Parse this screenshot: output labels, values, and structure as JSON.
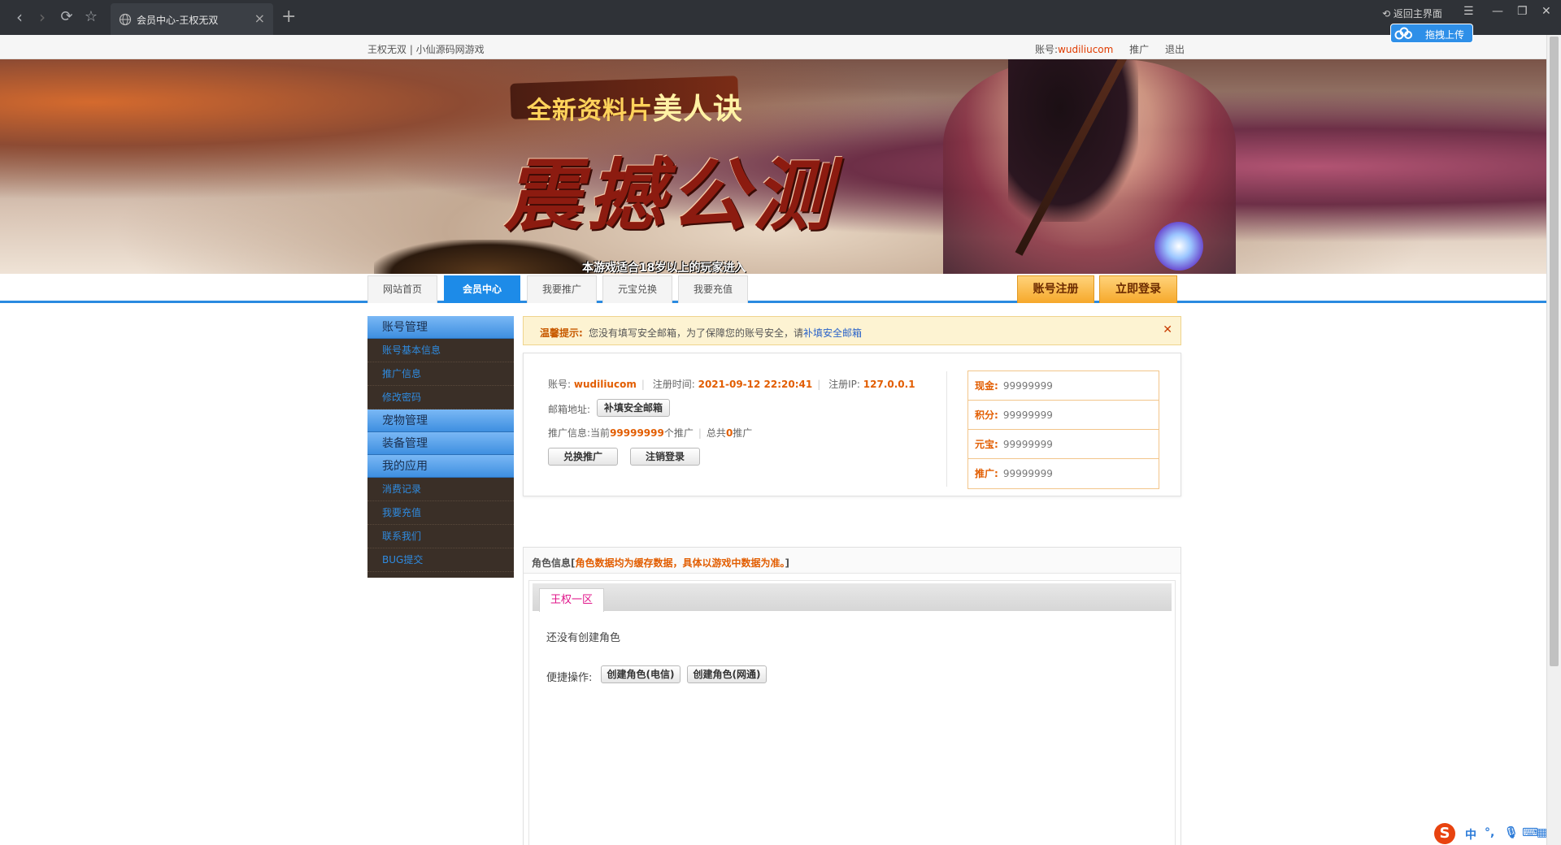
{
  "browser": {
    "tab_title": "会员中心-王权无双",
    "back_home": "返回主界面",
    "upload_label": "拖拽上传"
  },
  "topbar": {
    "site_name": "王权无双 | 小仙源码网游戏",
    "account_label": "账号:",
    "account_name": "wudiliucom",
    "promote_link": "推广",
    "logout_link": "退出"
  },
  "banner": {
    "subtitle_prefix": "全新资料片",
    "subtitle_highlight": "美人诀",
    "title": "震撼公测",
    "age_notice": "本游戏适合18岁以上的玩家进入"
  },
  "nav": {
    "tabs": [
      "网站首页",
      "会员中心",
      "我要推广",
      "元宝兑换",
      "我要充值"
    ],
    "active_index": 1,
    "register": "账号注册",
    "login": "立即登录"
  },
  "sidebar": {
    "sections": [
      {
        "title": "账号管理",
        "items": [
          "账号基本信息",
          "推广信息",
          "修改密码"
        ]
      },
      {
        "title": "宠物管理",
        "items": []
      },
      {
        "title": "装备管理",
        "items": []
      },
      {
        "title": "我的应用",
        "items": [
          "消费记录",
          "我要充值",
          "联系我们",
          "BUG提交"
        ]
      }
    ]
  },
  "notice": {
    "label": "温馨提示:",
    "text": "您没有填写安全邮箱，为了保障您的账号安全，请",
    "link": "补填安全邮箱"
  },
  "account": {
    "acc_label": "账号:",
    "acc_value": "wudiliucom",
    "reg_time_label": "注册时间:",
    "reg_time_value": "2021-09-12 22:20:41",
    "reg_ip_label": "注册IP:",
    "reg_ip_value": "127.0.0.1",
    "email_label": "邮箱地址:",
    "email_button": "补填安全邮箱",
    "promo_label": "推广信息:",
    "promo_prefix": "当前",
    "promo_current": "99999999",
    "promo_mid": "个推广",
    "promo_total_prefix": "总共",
    "promo_total": "0",
    "promo_suffix": "推广",
    "exchange_button": "兑换推广",
    "cancel_button": "注销登录",
    "stats": [
      {
        "label": "现金:",
        "value": "99999999"
      },
      {
        "label": "积分:",
        "value": "99999999"
      },
      {
        "label": "元宝:",
        "value": "99999999"
      },
      {
        "label": "推广:",
        "value": "99999999"
      }
    ]
  },
  "role": {
    "header_prefix": "角色信息[",
    "header_note": "角色数据均为缓存数据，具体以游戏中数据为准。",
    "header_suffix": "]",
    "server_tab": "王权一区",
    "no_role": "还没有创建角色",
    "quick_label": "便捷操作:",
    "create_telecom": "创建角色(电信)",
    "create_netcom": "创建角色(网通)"
  },
  "tray": {
    "ime_logo": "S",
    "lang": "中"
  }
}
